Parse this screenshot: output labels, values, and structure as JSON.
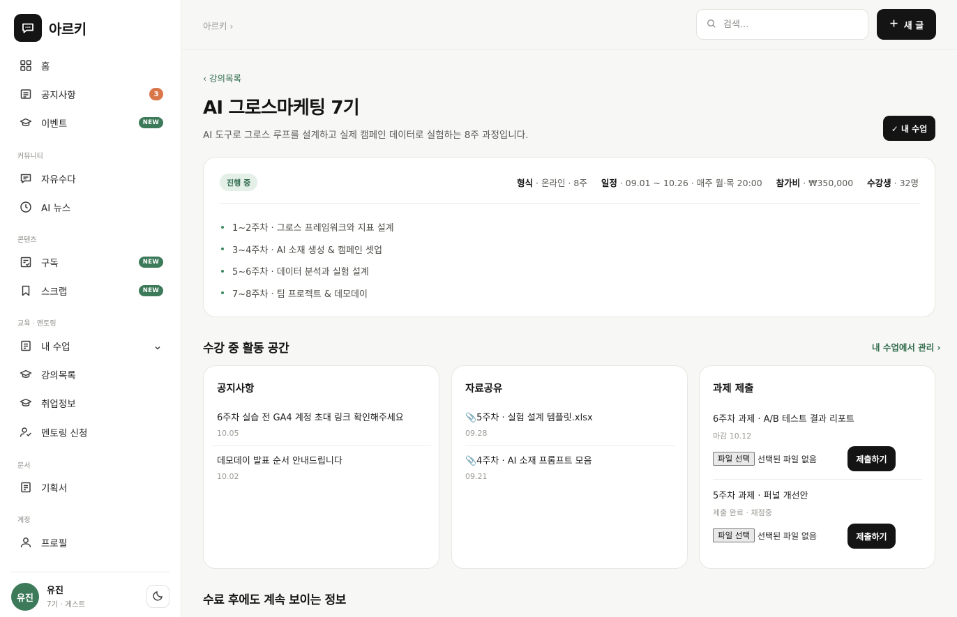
{
  "brand": {
    "name": "아르키",
    "icon": "chat-bubble-icon"
  },
  "sidebar": {
    "items": [
      {
        "label": "홈",
        "icon": "grid-icon"
      },
      {
        "label": "공지사항",
        "icon": "notice-icon",
        "badge": "3"
      },
      {
        "label": "이벤트",
        "icon": "graduation-cap-icon",
        "badge": "NEW"
      },
      {
        "label": "자유수다",
        "icon": "chat-icon"
      },
      {
        "label": "AI 뉴스",
        "icon": "clock-icon"
      },
      {
        "label": "구독",
        "icon": "subscribe-icon",
        "badge": "NEW"
      },
      {
        "label": "스크랩",
        "icon": "bookmark-icon",
        "badge": "NEW"
      },
      {
        "label": "내 수업",
        "icon": "document-icon"
      },
      {
        "label": "강의목록",
        "icon": "graduation-cap-icon"
      },
      {
        "label": "취업정보",
        "icon": "graduation-cap-icon"
      },
      {
        "label": "멘토링 신청",
        "icon": "user-check-icon"
      },
      {
        "label": "기획서",
        "icon": "document-icon"
      },
      {
        "label": "프로필",
        "icon": "user-icon"
      }
    ],
    "sections": {
      "community": "커뮤니티",
      "contents": "콘텐츠",
      "education": "교육 · 멘토링",
      "docs": "문서",
      "account": "계정"
    }
  },
  "user": {
    "avatar": "유진",
    "name": "유진",
    "meta": "7기 · 게스트"
  },
  "topbar": {
    "breadcrumb": "아르키 ›",
    "search_placeholder": "검색...",
    "new_post_label": "새 글"
  },
  "course": {
    "back_label": "‹ 강의목록",
    "title": "AI 그로스마케팅 7기",
    "description": "AI 도구로 그로스 루프를 설계하고 실제 캠페인 데이터로 실험하는 8주 과정입니다.",
    "my_class_label": "✓ 내 수업",
    "status": "진행 중",
    "meta": [
      {
        "label": "형식",
        "value": " · 온라인 · 8주"
      },
      {
        "label": "일정",
        "value": " · 09.01 ~ 10.26 · 매주 월·목 20:00"
      },
      {
        "label": "참가비",
        "value": " · ₩350,000"
      },
      {
        "label": "수강생",
        "value": " · 32명"
      }
    ],
    "curriculum": [
      "1~2주차 · 그로스 프레임워크와 지표 설계",
      "3~4주차 · AI 소재 생성 & 캠페인 셋업",
      "5~6주차 · 데이터 분석과 실험 설계",
      "7~8주차 · 팀 프로젝트 & 데모데이"
    ]
  },
  "activity": {
    "title": "수강 중 활동 공간",
    "manage_label": "내 수업에서 관리 ›",
    "notices": {
      "title": "공지사항",
      "posts": [
        {
          "title": "6주차 실습 전 GA4 계정 초대 링크 확인해주세요",
          "date": "10.05"
        },
        {
          "title": "데모데이 발표 순서 안내드립니다",
          "date": "10.02"
        }
      ]
    },
    "resources": {
      "title": "자료공유",
      "posts": [
        {
          "title": "📎5주차 · 실험 설계 템플릿.xlsx",
          "date": "09.28"
        },
        {
          "title": "📎4주차 · AI 소재 프롬프트 모음",
          "date": "09.21"
        }
      ]
    },
    "assignments": {
      "title": "과제 제출",
      "file_button": "파일 선택",
      "no_file": "선택된 파일 없음",
      "submit_label": "제출하기",
      "tasks": [
        {
          "title": "6주차 과제 · A/B 테스트 결과 리포트",
          "meta": "마감 10.12"
        },
        {
          "title": "5주차 과제 · 퍼널 개선안",
          "meta": "제출 완료 · 채점중"
        }
      ]
    }
  },
  "after": {
    "title": "수료 후에도 계속 보이는 정보"
  }
}
